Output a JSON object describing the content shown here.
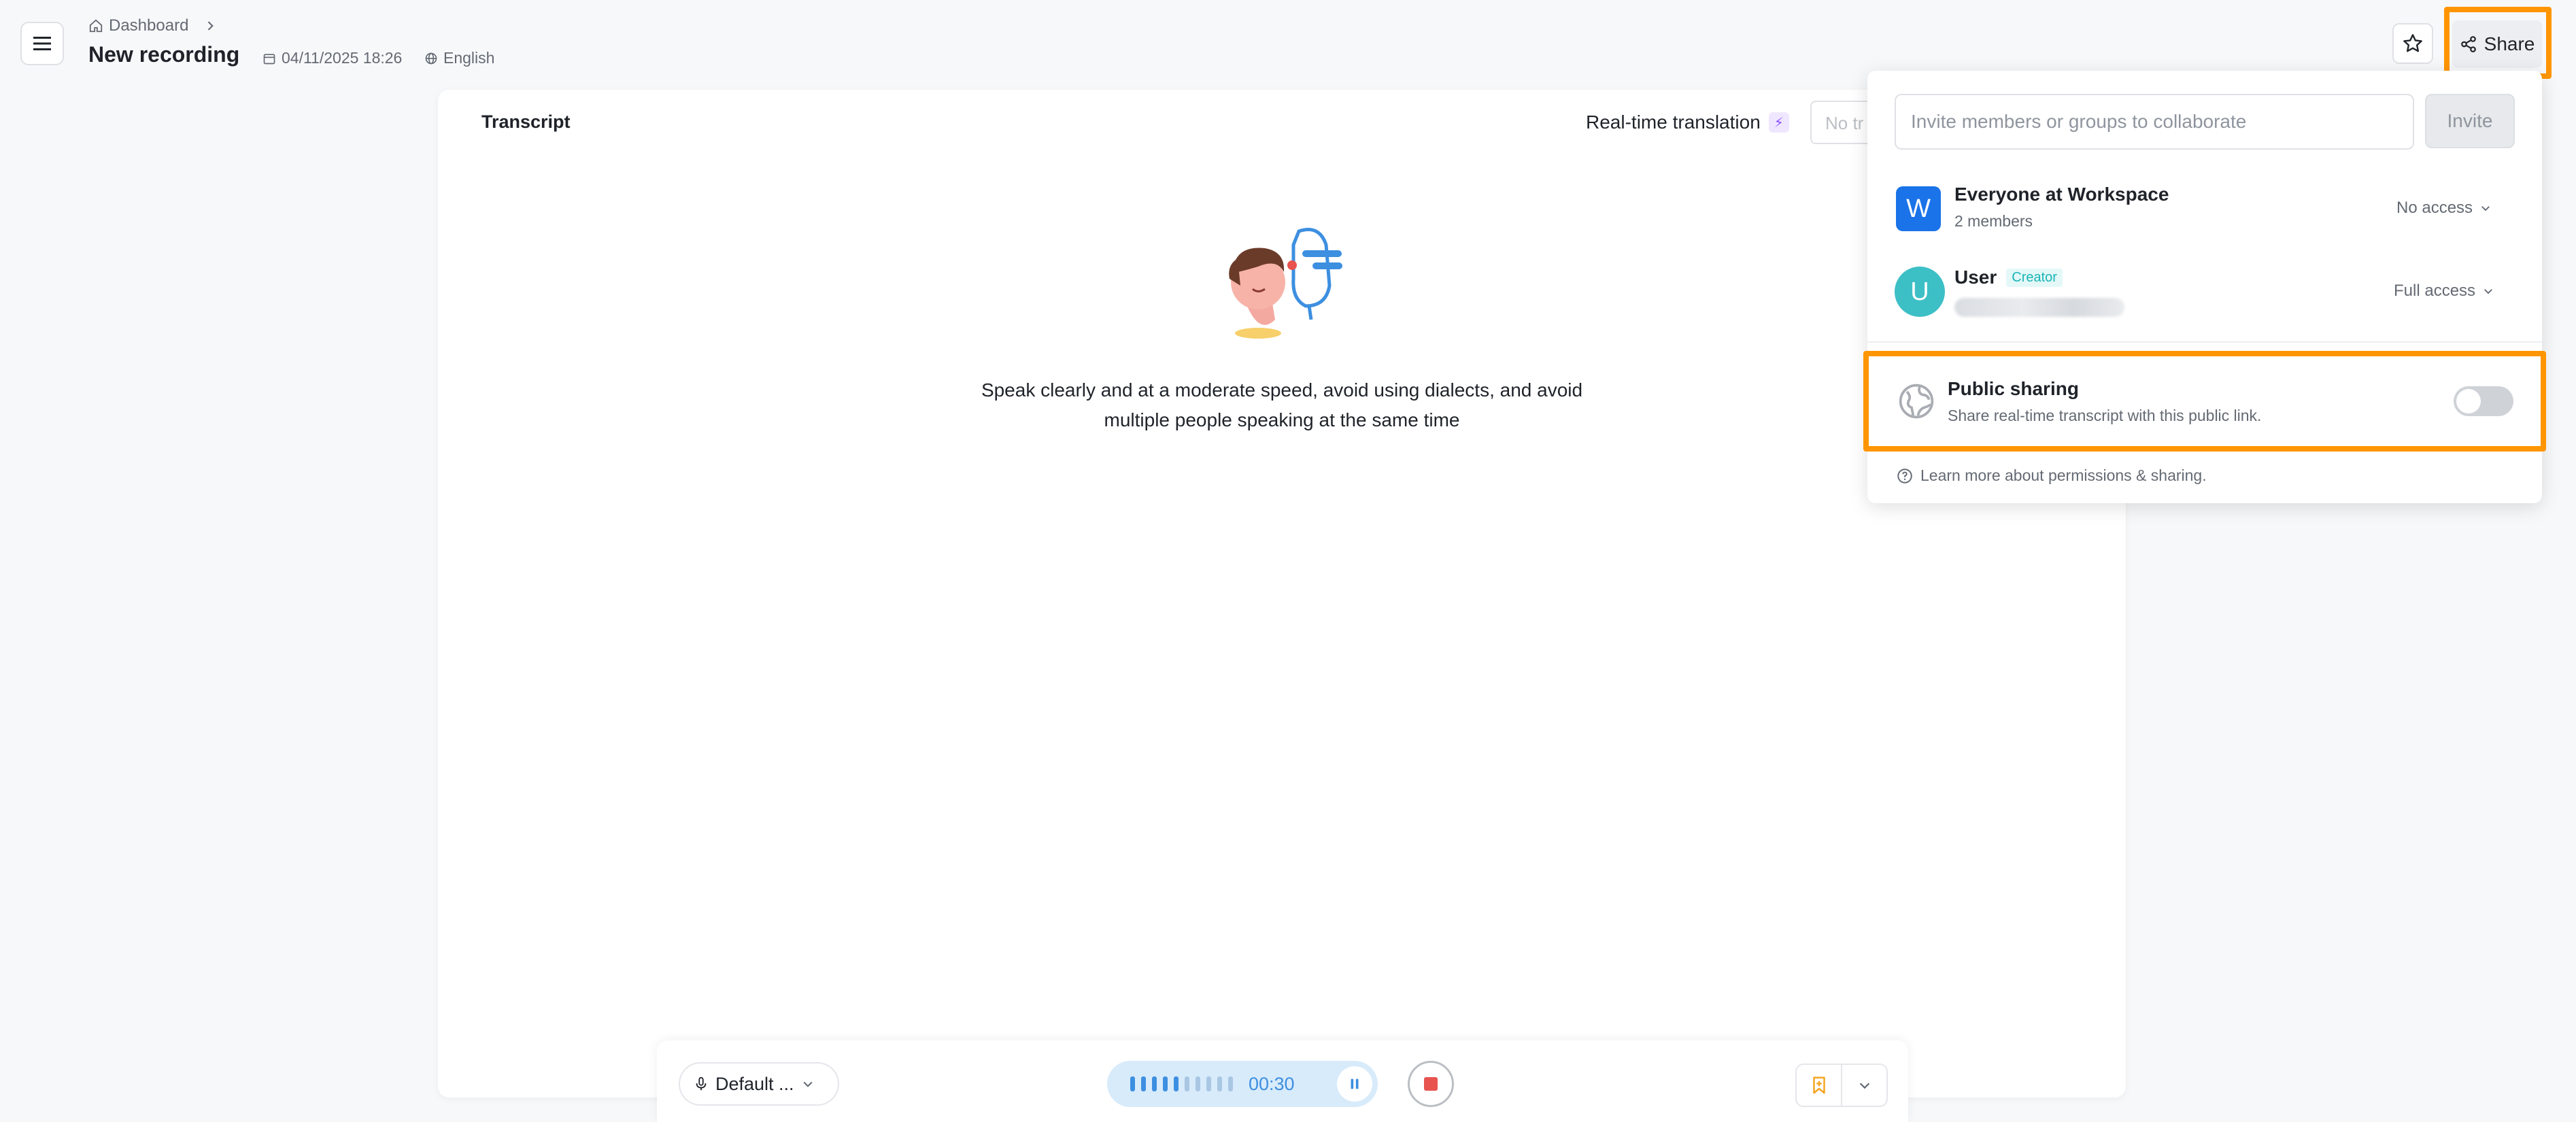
{
  "header": {
    "breadcrumb": "Dashboard",
    "title": "New recording",
    "date": "04/11/2025 18:26",
    "language": "English",
    "share_label": "Share"
  },
  "transcript": {
    "title": "Transcript",
    "realtime_label": "Real-time translation",
    "translation_select_value": "No tr",
    "hint_line1": "Speak clearly and at a moderate speed, avoid using dialects, and avoid",
    "hint_line2": "multiple people speaking at the same time"
  },
  "recorder": {
    "mic_label": "Default ...",
    "timer": "00:30",
    "level_active_bars": 5,
    "level_total_bars": 10
  },
  "share_panel": {
    "invite_placeholder": "Invite members or groups to collaborate",
    "invite_button": "Invite",
    "members": [
      {
        "avatar_letter": "W",
        "name": "Everyone at Workspace",
        "sub": "2 members",
        "access": "No access",
        "avatar_color": "#1a73e8"
      },
      {
        "avatar_letter": "U",
        "name": "User",
        "tag": "Creator",
        "access": "Full access",
        "avatar_color": "#3dbfc6"
      }
    ],
    "public_sharing": {
      "title": "Public sharing",
      "description": "Share real-time transcript with this public link.",
      "enabled": false
    },
    "learn_more": "Learn more about permissions & sharing."
  },
  "colors": {
    "highlight": "#ff9500",
    "accent": "#3d8fe0"
  }
}
